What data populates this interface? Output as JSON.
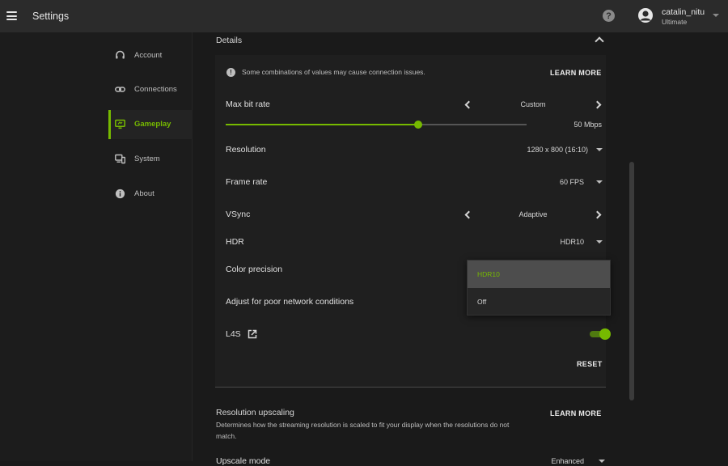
{
  "header": {
    "title": "Settings",
    "user_name": "catalin_nitu",
    "user_tier": "Ultimate",
    "help_symbol": "?"
  },
  "sidebar": {
    "items": [
      {
        "label": "Account",
        "icon": "headset-icon"
      },
      {
        "label": "Connections",
        "icon": "link-icon"
      },
      {
        "label": "Gameplay",
        "icon": "monitor-icon",
        "active": true
      },
      {
        "label": "System",
        "icon": "devices-icon"
      },
      {
        "label": "About",
        "icon": "info-icon"
      }
    ]
  },
  "details": {
    "title": "Details",
    "notice": "Some combinations of values may cause connection issues.",
    "notice_symbol": "!",
    "learn_more": "LEARN MORE",
    "max_bit_rate": {
      "label": "Max bit rate",
      "mode": "Custom",
      "value": "50 Mbps",
      "slider_fraction": 0.64
    },
    "resolution": {
      "label": "Resolution",
      "value": "1280 x 800 (16:10)"
    },
    "frame_rate": {
      "label": "Frame rate",
      "value": "60 FPS"
    },
    "vsync": {
      "label": "VSync",
      "value": "Adaptive"
    },
    "hdr": {
      "label": "HDR",
      "value": "HDR10"
    },
    "color_precision": {
      "label": "Color precision"
    },
    "poor_network": {
      "label": "Adjust for poor network conditions"
    },
    "l4s": {
      "label": "L4S",
      "enabled": true
    },
    "reset": "RESET"
  },
  "upscaling": {
    "title": "Resolution upscaling",
    "description": "Determines how the streaming resolution is scaled to fit your display when the resolutions do not match.",
    "learn_more": "LEARN MORE",
    "upscale_mode_label": "Upscale mode",
    "upscale_mode_value": "Enhanced"
  },
  "hdr_dropdown": {
    "options": [
      "HDR10",
      "Off"
    ],
    "selected": "HDR10"
  },
  "colors": {
    "accent": "#76b900",
    "background": "#1a1a1a",
    "panel": "#1f1f1f",
    "topbar": "#2b2b2b"
  }
}
